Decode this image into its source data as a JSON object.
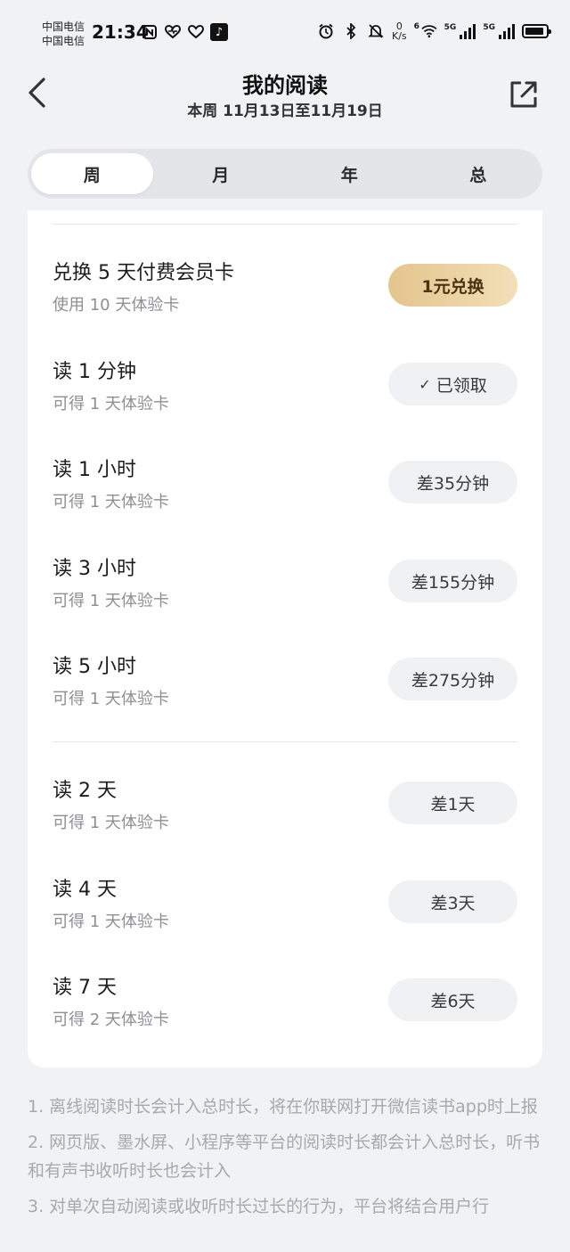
{
  "status_bar": {
    "carrier_1": "中国电信",
    "carrier_2": "中国电信",
    "time": "21:34",
    "net_speed_value": "0",
    "net_speed_unit": "K/s",
    "wifi_label": "6",
    "sim1_label": "5G",
    "sim2_label": "5G",
    "battery_level": 0.9
  },
  "header": {
    "title": "我的阅读",
    "subtitle": "本周 11月13日至11月19日"
  },
  "tabs": [
    {
      "label": "周",
      "active": true
    },
    {
      "label": "月",
      "active": false
    },
    {
      "label": "年",
      "active": false
    },
    {
      "label": "总",
      "active": false
    }
  ],
  "rewards": [
    {
      "title": "兑换 5 天付费会员卡",
      "desc": "使用 10 天体验卡",
      "button": "1元兑换",
      "style": "gold"
    },
    {
      "title": "读 1 分钟",
      "desc": "可得 1 天体验卡",
      "button": "已领取",
      "style": "claimed"
    },
    {
      "title": "读 1 小时",
      "desc": "可得 1 天体验卡",
      "button": "差35分钟",
      "style": "normal"
    },
    {
      "title": "读 3 小时",
      "desc": "可得 1 天体验卡",
      "button": "差155分钟",
      "style": "normal"
    },
    {
      "title": "读 5 小时",
      "desc": "可得 1 天体验卡",
      "button": "差275分钟",
      "style": "normal"
    },
    {
      "title": "读 2 天",
      "desc": "可得 1 天体验卡",
      "button": "差1天",
      "style": "normal"
    },
    {
      "title": "读 4 天",
      "desc": "可得 1 天体验卡",
      "button": "差3天",
      "style": "normal"
    },
    {
      "title": "读 7 天",
      "desc": "可得 2 天体验卡",
      "button": "差6天",
      "style": "normal"
    }
  ],
  "notes": [
    "1. 离线阅读时长会计入总时长，将在你联网打开微信读书app时上报",
    "2. 网页版、墨水屏、小程序等平台的阅读时长都会计入总时长，听书和有声书收听时长也会计入",
    "3. 对单次自动阅读或收听时长过长的行为，平台将结合用户行"
  ],
  "colors": {
    "background": "#f1f2f4",
    "card": "#ffffff",
    "gold_button": "#e9cf9f",
    "pill": "#f0f1f3",
    "note_text": "#a8a8ad"
  }
}
